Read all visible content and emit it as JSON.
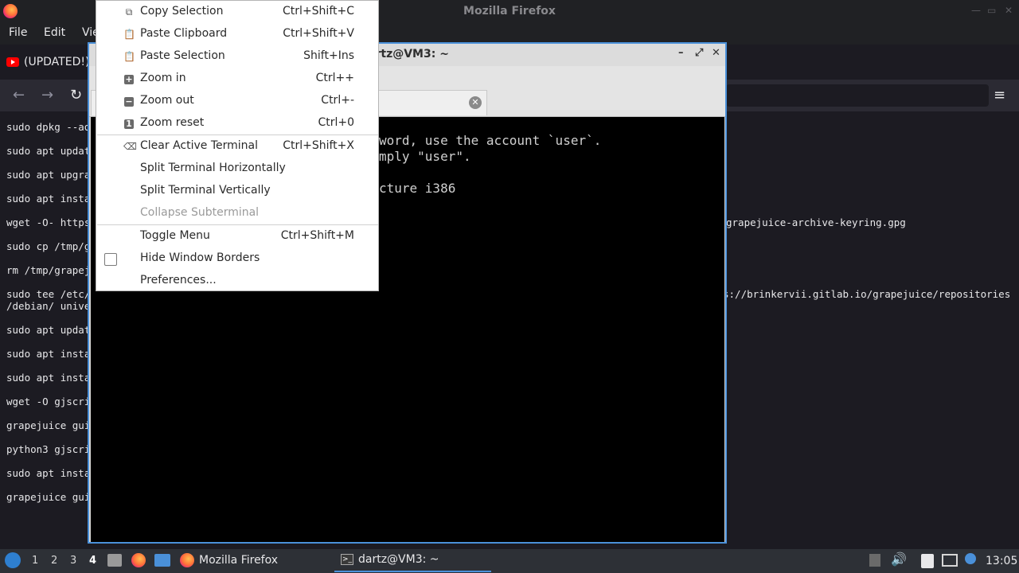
{
  "firefox": {
    "title": "Mozilla Firefox",
    "menu": {
      "file": "File",
      "edit": "Edit",
      "view": "Vie"
    },
    "tab_title": "(UPDATED!)"
  },
  "page_commands": [
    "sudo dpkg --ad",
    "sudo apt updat",
    "sudo apt upgra",
    "sudo apt insta",
    "wget -O- https",
    "sudo cp /tmp/g",
    "rm /tmp/grapej",
    "sudo tee /etc/",
    "/debian/ unive",
    "sudo apt updat",
    "sudo apt insta",
    "sudo apt insta",
    "wget -O gjscri",
    "grapejuice gui",
    "python3 gjscri",
    "sudo apt insta",
    "grapejuice gui"
  ],
  "page_right_text": {
    "keyring": "grapejuice-archive-keyring.gpg",
    "repo": "s://brinkervii.gitlab.io/grapejuice/repositories"
  },
  "terminal": {
    "title": "dartz@VM3: ~",
    "lines": [
      "word, use the account `user`.",
      "mply \"user\".",
      "",
      "cture i386"
    ]
  },
  "context_menu": {
    "items": [
      {
        "label": "Copy Selection",
        "accel": "Ctrl+Shift+C",
        "icon": "copy-icon"
      },
      {
        "label": "Paste Clipboard",
        "accel": "Ctrl+Shift+V",
        "icon": "paste-icon"
      },
      {
        "label": "Paste Selection",
        "accel": "Shift+Ins",
        "icon": "paste-icon"
      },
      {
        "label": "Zoom in",
        "accel": "Ctrl++",
        "icon": "zoom-in-icon"
      },
      {
        "label": "Zoom out",
        "accel": "Ctrl+-",
        "icon": "zoom-out-icon"
      },
      {
        "label": "Zoom reset",
        "accel": "Ctrl+0",
        "icon": "zoom-reset-icon"
      },
      {
        "label": "Clear Active Terminal",
        "accel": "Ctrl+Shift+X",
        "icon": "clear-icon"
      },
      {
        "label": "Split Terminal Horizontally",
        "accel": ""
      },
      {
        "label": "Split Terminal Vertically",
        "accel": ""
      },
      {
        "label": "Collapse Subterminal",
        "accel": "",
        "disabled": true
      },
      {
        "label": "Toggle Menu",
        "accel": "Ctrl+Shift+M"
      },
      {
        "label": "Hide Window Borders",
        "accel": "",
        "checkbox": false
      },
      {
        "label": "Preferences...",
        "accel": ""
      }
    ]
  },
  "taskbar": {
    "workspaces": [
      "1",
      "2",
      "3",
      "4"
    ],
    "active_workspace": "4",
    "task_firefox": "Mozilla Firefox",
    "task_terminal": "dartz@VM3: ~",
    "clock": "13:05"
  },
  "colors": {
    "accent": "#4a90d9",
    "firefox_bg": "#1c1b22",
    "taskbar_bg": "#2d3036",
    "terminal_bg": "#000000"
  }
}
